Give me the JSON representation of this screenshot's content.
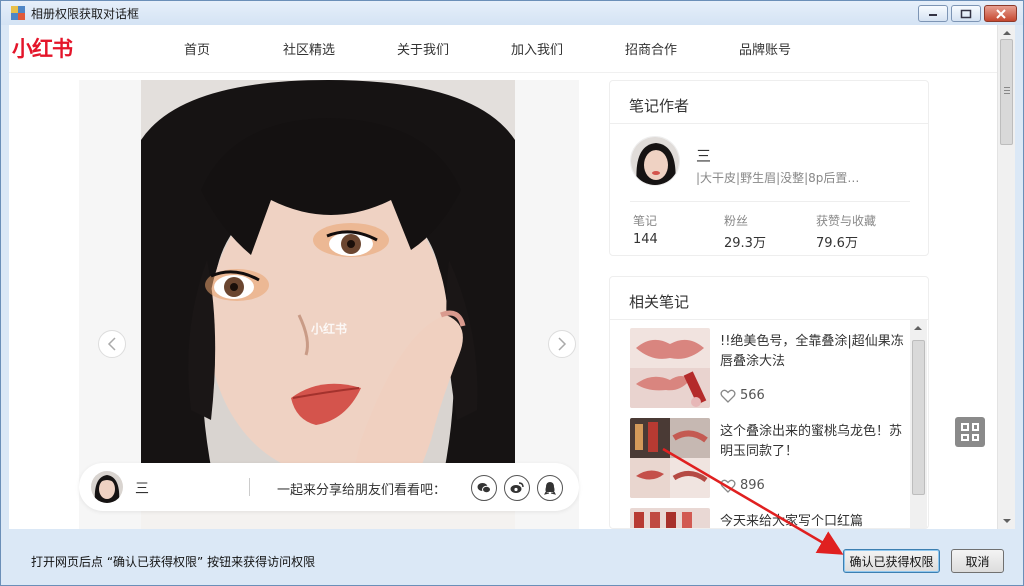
{
  "window": {
    "title": "相册权限获取对话框"
  },
  "site": {
    "logo": "小红书",
    "nav": [
      "首页",
      "社区精选",
      "关于我们",
      "加入我们",
      "招商合作",
      "品牌账号"
    ]
  },
  "photo": {
    "watermark": "小红书",
    "prev_icon": "chevron-left-icon",
    "next_icon": "chevron-right-icon"
  },
  "share_bar": {
    "user_name": "三",
    "prompt": "一起来分享给朋友们看看吧：",
    "icons": [
      "wechat-icon",
      "weibo-icon",
      "qq-icon"
    ]
  },
  "author_card": {
    "title": "笔记作者",
    "name": "三",
    "description": "|大干皮|野生眉|没整|8p后置…",
    "stats": [
      {
        "label": "笔记",
        "value": "144"
      },
      {
        "label": "粉丝",
        "value": "29.3万"
      },
      {
        "label": "获赞与收藏",
        "value": "79.6万"
      }
    ]
  },
  "related_card": {
    "title": "相关笔记",
    "items": [
      {
        "title": "!!绝美色号，全靠叠涂|超仙果冻唇叠涂大法",
        "likes": "566"
      },
      {
        "title": "这个叠涂出来的蜜桃乌龙色！苏明玉同款了！",
        "likes": "896"
      },
      {
        "title": "今天来给大家写个口红篇",
        "likes": ""
      }
    ]
  },
  "dialog": {
    "instruction": "打开网页后点 “确认已获得权限” 按钮来获得访问权限",
    "confirm_label": "确认已获得权限",
    "cancel_label": "取消"
  },
  "colors": {
    "brand_red": "#e4152a",
    "arrow_red": "#e02020"
  }
}
